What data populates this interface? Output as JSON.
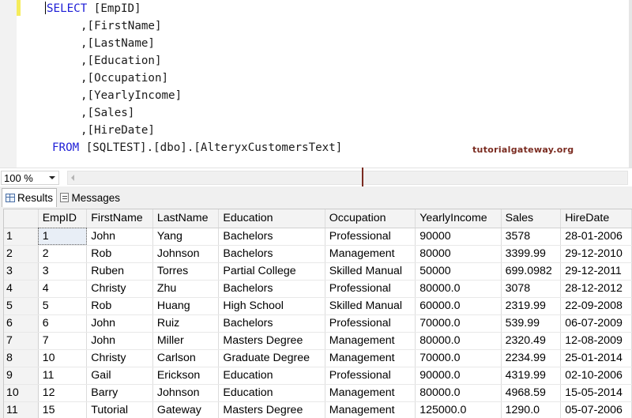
{
  "editor": {
    "code_lines": [
      {
        "kw": "SELECT",
        "text": " [EmpID]"
      },
      {
        "kw": "",
        "text": ",[FirstName]"
      },
      {
        "kw": "",
        "text": ",[LastName]"
      },
      {
        "kw": "",
        "text": ",[Education]"
      },
      {
        "kw": "",
        "text": ",[Occupation]"
      },
      {
        "kw": "",
        "text": ",[YearlyIncome]"
      },
      {
        "kw": "",
        "text": ",[Sales]"
      },
      {
        "kw": "",
        "text": ",[HireDate]"
      },
      {
        "kw": "FROM",
        "text": " [SQLTEST].[dbo].[AlteryxCustomersText]"
      }
    ],
    "watermark": "tutorialgateway.org"
  },
  "zoom": {
    "value": "100 %"
  },
  "results": {
    "tabs": [
      {
        "label": "Results",
        "icon": "grid-icon",
        "active": true
      },
      {
        "label": "Messages",
        "icon": "message-icon",
        "active": false
      }
    ],
    "columns": [
      "",
      "EmpID",
      "FirstName",
      "LastName",
      "Education",
      "Occupation",
      "YearlyIncome",
      "Sales",
      "HireDate"
    ],
    "rows": [
      [
        "1",
        "1",
        "John",
        "Yang",
        "Bachelors",
        "Professional",
        "90000",
        "3578",
        "28-01-2006"
      ],
      [
        "2",
        "2",
        "Rob",
        "Johnson",
        "Bachelors",
        "Management",
        "80000",
        "3399.99",
        "29-12-2010"
      ],
      [
        "3",
        "3",
        "Ruben",
        "Torres",
        "Partial College",
        "Skilled Manual",
        "50000",
        "699.0982",
        "29-12-2011"
      ],
      [
        "4",
        "4",
        "Christy",
        "Zhu",
        "Bachelors",
        "Professional",
        "80000.0",
        "3078",
        "28-12-2012"
      ],
      [
        "5",
        "5",
        "Rob",
        "Huang",
        "High School",
        "Skilled Manual",
        "60000.0",
        "2319.99",
        "22-09-2008"
      ],
      [
        "6",
        "6",
        "John",
        "Ruiz",
        "Bachelors",
        "Professional",
        "70000.0",
        "539.99",
        "06-07-2009"
      ],
      [
        "7",
        "7",
        "John",
        "Miller",
        "Masters Degree",
        "Management",
        "80000.0",
        "2320.49",
        "12-08-2009"
      ],
      [
        "8",
        "10",
        "Christy",
        "Carlson",
        "Graduate Degree",
        "Management",
        "70000.0",
        "2234.99",
        "25-01-2014"
      ],
      [
        "9",
        "11",
        "Gail",
        "Erickson",
        "Education",
        "Professional",
        "90000.0",
        "4319.99",
        "02-10-2006"
      ],
      [
        "10",
        "12",
        "Barry",
        "Johnson",
        "Education",
        "Management",
        "80000.0",
        "4968.59",
        "15-05-2014"
      ],
      [
        "11",
        "15",
        "Tutorial",
        "Gateway",
        "Masters Degree",
        "Management",
        "125000.0",
        "1290.0",
        "05-07-2006"
      ]
    ]
  }
}
